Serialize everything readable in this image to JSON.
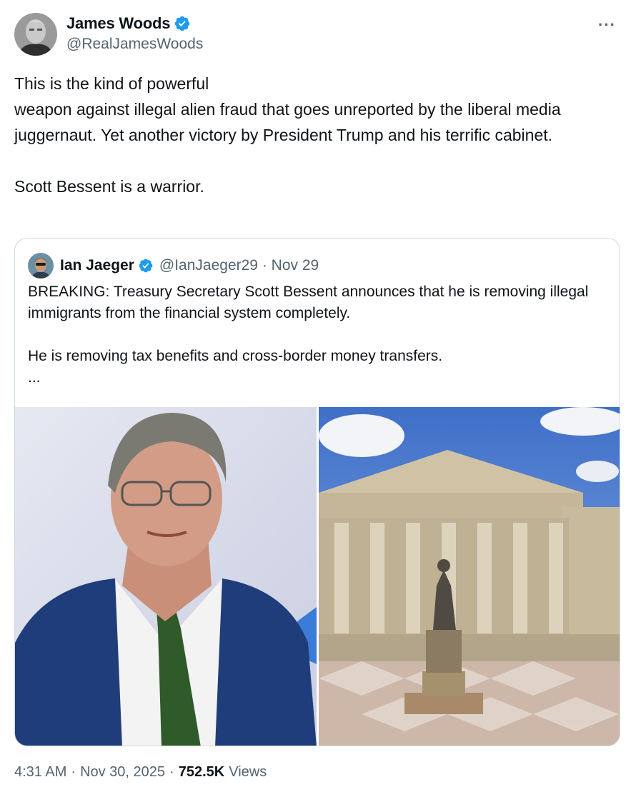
{
  "author": {
    "display_name": "James Woods",
    "handle": "@RealJamesWoods",
    "verified": true
  },
  "more_icon": "more-horizontal-icon",
  "tweet": {
    "text": "This is the kind of powerful\nweapon against illegal alien fraud that goes unreported by the liberal media juggernaut. Yet another victory by President Trump and his terrific cabinet.\n\nScott Bessent is a warrior."
  },
  "quoted_tweet": {
    "display_name": "Ian Jaeger",
    "handle_date": "@IanJaeger29 · Nov 29",
    "verified": true,
    "text": "BREAKING: Treasury Secretary Scott Bessent announces that he is removing illegal immigrants from the financial system completely.\n\nHe is removing tax benefits and cross-border money transfers.\n...",
    "media": [
      {
        "alt": "photo-of-man-in-blue-suit"
      },
      {
        "alt": "photo-of-treasury-building"
      }
    ]
  },
  "meta": {
    "time": "4:31 AM",
    "date": "Nov 30, 2025",
    "views_count": "752.5K",
    "views_label": "Views"
  },
  "colors": {
    "verified_blue": "#1d9bf0",
    "secondary_text": "#536471",
    "border": "#cfd9de"
  }
}
